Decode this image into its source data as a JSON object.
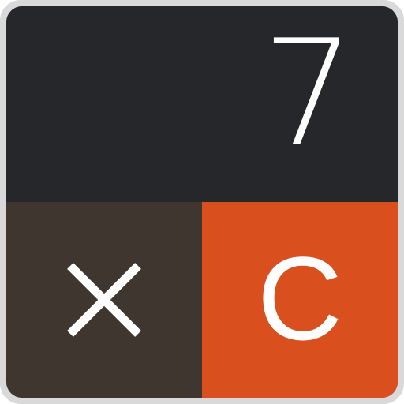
{
  "display": {
    "value": "7"
  },
  "keys": {
    "multiply": {
      "icon": "multiply-icon",
      "color": "#3f372f"
    },
    "clear": {
      "label": "C",
      "color": "#d94f1e"
    }
  },
  "colors": {
    "display_background": "#26272b",
    "frame": "#d9d9d9",
    "text": "#ffffff"
  }
}
